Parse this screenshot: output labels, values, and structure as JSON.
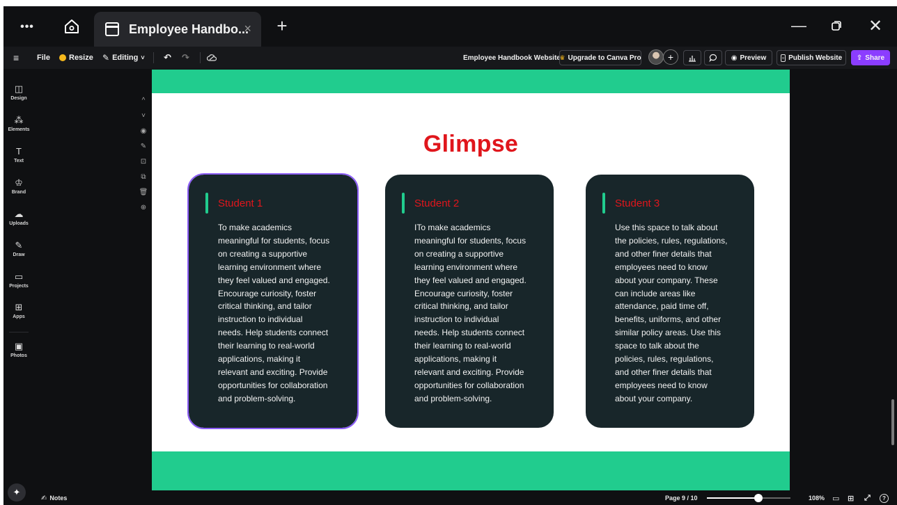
{
  "browser": {
    "tab_title": "Employee Handbo...",
    "tab_close": "×",
    "new_tab": "+",
    "menu_dots": "•••",
    "minimize": "—",
    "close": "✕"
  },
  "toolbar": {
    "menu": "≡",
    "file": "File",
    "resize": "Resize",
    "editing": "Editing",
    "doc_title": "Employee Handbook Website",
    "upgrade": "Upgrade to Canva Pro",
    "preview": "Preview",
    "publish": "Publish Website",
    "share": "Share"
  },
  "sidebar": {
    "items": [
      {
        "label": "Design",
        "icon": "design-icon",
        "glyph": "◫"
      },
      {
        "label": "Elements",
        "icon": "elements-icon",
        "glyph": "⁂"
      },
      {
        "label": "Text",
        "icon": "text-icon",
        "glyph": "T"
      },
      {
        "label": "Brand",
        "icon": "brand-icon",
        "glyph": "♔"
      },
      {
        "label": "Uploads",
        "icon": "uploads-icon",
        "glyph": "☁"
      },
      {
        "label": "Draw",
        "icon": "draw-icon",
        "glyph": "✎"
      },
      {
        "label": "Projects",
        "icon": "projects-icon",
        "glyph": "▭"
      },
      {
        "label": "Apps",
        "icon": "apps-icon",
        "glyph": "⊞"
      },
      {
        "label": "Photos",
        "icon": "photos-icon",
        "glyph": "▣"
      }
    ]
  },
  "page_tools": [
    "^",
    "˅",
    "◉",
    "✎",
    "⊡",
    "⧉",
    "🗑",
    "⊕"
  ],
  "canvas": {
    "heading": "Glimpse",
    "cards": [
      {
        "title": "Student 1",
        "body": "To make academics\nmeaningful for students, focus\non creating a supportive\nlearning environment where\nthey feel valued and engaged.\nEncourage curiosity, foster\ncritical thinking, and tailor\ninstruction to individual\nneeds. Help students connect\ntheir learning to real-world\napplications, making it\nrelevant and exciting. Provide\nopportunities for collaboration\nand problem-solving."
      },
      {
        "title": "Student 2",
        "body": "ITo make academics\nmeaningful for students, focus\non creating a supportive\nlearning environment where\nthey feel valued and engaged.\nEncourage curiosity, foster\ncritical thinking, and tailor\ninstruction to individual\nneeds. Help students connect\ntheir learning to real-world\napplications, making it\nrelevant and exciting. Provide\nopportunities for collaboration\nand problem-solving."
      },
      {
        "title": "Student 3",
        "body": "Use this space to talk about\nthe policies, rules, regulations,\nand other finer details that\nemployees need to know\nabout your company. These\ncan include areas like\nattendance, paid time off,\nbenefits, uniforms, and other\nsimilar policy areas. Use this\nspace to talk about the\npolicies, rules, regulations,\nand other finer details that\nemployees need to know\nabout your company."
      }
    ]
  },
  "status": {
    "notes": "Notes",
    "page": "Page 9 / 10",
    "zoom": "108%",
    "zoom_level": 0.62,
    "help": "?"
  },
  "colors": {
    "accent_green": "#21cc8e",
    "heading_red": "#e0161c",
    "card_bg": "#18262a",
    "brand_purple": "#8b3dff"
  }
}
